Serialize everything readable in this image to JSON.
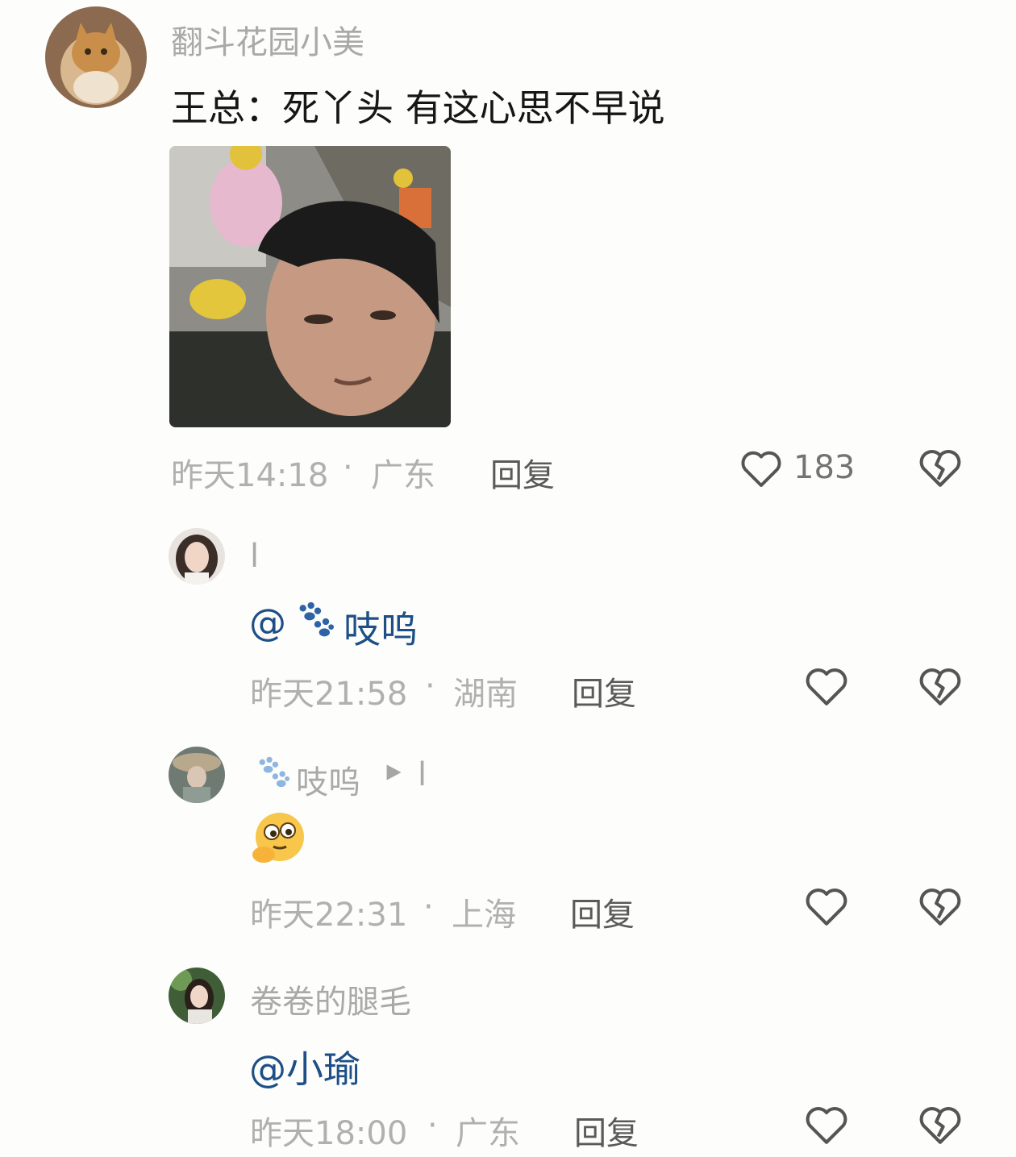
{
  "comments": [
    {
      "avatar_icon": "cat-avatar-icon",
      "username": "翻斗花园小美",
      "text": "王总：死丫头 有这心思不早说",
      "media_icon": "meme-image-man-selfie",
      "timestamp": "昨天14:18",
      "separator": "·",
      "location": "广东",
      "reply_label": "回复",
      "like_count": "183",
      "replies": [
        {
          "avatar_icon": "woman-avatar-icon",
          "username": "l",
          "paw_icon": "paw-icon",
          "mention": "@",
          "mention_name": "吱呜",
          "timestamp": "昨天21:58",
          "separator": "·",
          "location": "湖南",
          "reply_label": "回复"
        },
        {
          "avatar_icon": "hat-avatar-icon",
          "paw_icon": "paw-icon",
          "username": "吱呜",
          "reply_arrow_icon": "play-triangle-icon",
          "reply_to": "l",
          "emoji_icon": "eyes-emoji-icon",
          "timestamp": "昨天22:31",
          "separator": "·",
          "location": "上海",
          "reply_label": "回复"
        },
        {
          "avatar_icon": "girl-avatar-icon",
          "username": "卷卷的腿毛",
          "mention": "@小瑜",
          "timestamp": "昨天18:00",
          "separator": "·",
          "location": "广东",
          "reply_label": "回复"
        }
      ]
    }
  ],
  "colors": {
    "background": "#fdfdfb",
    "mention": "#1d4f86",
    "meta": "#b0b0b0",
    "username": "#a9a9a9",
    "icon_stroke": "#555555"
  }
}
